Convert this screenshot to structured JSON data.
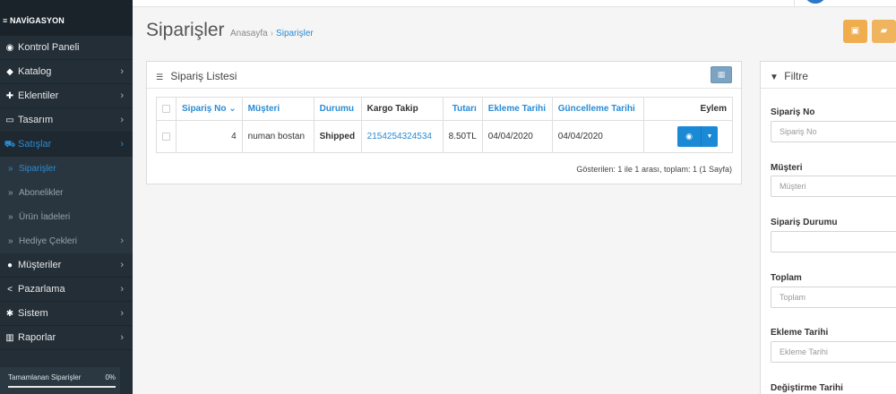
{
  "sidebar": {
    "header": "≡ NAVİGASYON",
    "items": [
      {
        "label": "Kontrol Paneli",
        "icon": "dashboard-icon",
        "glyph": "◉",
        "chevron": ""
      },
      {
        "label": "Katalog",
        "icon": "tag-icon",
        "glyph": "◆",
        "chevron": "›"
      },
      {
        "label": "Eklentiler",
        "icon": "puzzle-icon",
        "glyph": "✚",
        "chevron": "›"
      },
      {
        "label": "Tasarım",
        "icon": "monitor-icon",
        "glyph": "▭",
        "chevron": "›"
      },
      {
        "label": "Satışlar",
        "icon": "cart-icon",
        "glyph": "⛟",
        "chevron": "›"
      }
    ],
    "sub_items": [
      {
        "label": "Siparişler",
        "chevron": ""
      },
      {
        "label": "Abonelikler",
        "chevron": ""
      },
      {
        "label": "Ürün İadeleri",
        "chevron": ""
      },
      {
        "label": "Hediye Çekleri",
        "chevron": "›"
      }
    ],
    "items_after": [
      {
        "label": "Müşteriler",
        "icon": "user-icon",
        "glyph": "●",
        "chevron": "›"
      },
      {
        "label": "Pazarlama",
        "icon": "share-icon",
        "glyph": "<",
        "chevron": "›"
      },
      {
        "label": "Sistem",
        "icon": "gear-icon",
        "glyph": "✱",
        "chevron": "›"
      },
      {
        "label": "Raporlar",
        "icon": "bar-chart-icon",
        "glyph": "▥",
        "chevron": "›"
      }
    ],
    "progress": {
      "label": "Tamamlanan Siparişler",
      "percent_text": "0%",
      "value": 0
    }
  },
  "header": {
    "title": "Siparişler",
    "breadcrumb": [
      "Anasayfa",
      "›",
      "Siparişler"
    ]
  },
  "order_panel": {
    "title": "Sipariş Listesi",
    "columns": {
      "order_no": "Sipariş No",
      "sort_mark": "⌄",
      "customer": "Müşteri",
      "status": "Durumu",
      "tracking": "Kargo Takip",
      "total": "Tutarı",
      "date_added": "Ekleme Tarihi",
      "date_modified": "Güncelleme Tarihi",
      "action": "Eylem"
    },
    "rows": [
      {
        "order_no": "4",
        "customer": "numan bostan",
        "status": "Shipped",
        "tracking": "2154254324534",
        "total": "8.50TL",
        "date_added": "04/04/2020",
        "date_modified": "04/04/2020"
      }
    ],
    "pagination_text": "Gösterilen: 1 ile 1 arası, toplam: 1 (1 Sayfa)"
  },
  "filter": {
    "title": "Filtre",
    "order_no": {
      "label": "Sipariş No",
      "placeholder": "Sipariş No",
      "value": ""
    },
    "customer": {
      "label": "Müşteri",
      "placeholder": "Müşteri",
      "value": ""
    },
    "status": {
      "label": "Sipariş Durumu",
      "selected": ""
    },
    "total": {
      "label": "Toplam",
      "placeholder": "Toplam",
      "value": ""
    },
    "date_added": {
      "label": "Ekleme Tarihi",
      "placeholder": "Ekleme Tarihi",
      "value": ""
    },
    "date_modified": {
      "label": "Değiştirme Tarihi"
    }
  },
  "colors": {
    "sidebar_bg": "#232e37",
    "accent": "#2a8bd4",
    "warning": "#f0ad4e",
    "primary_button": "#1b8ad6"
  }
}
